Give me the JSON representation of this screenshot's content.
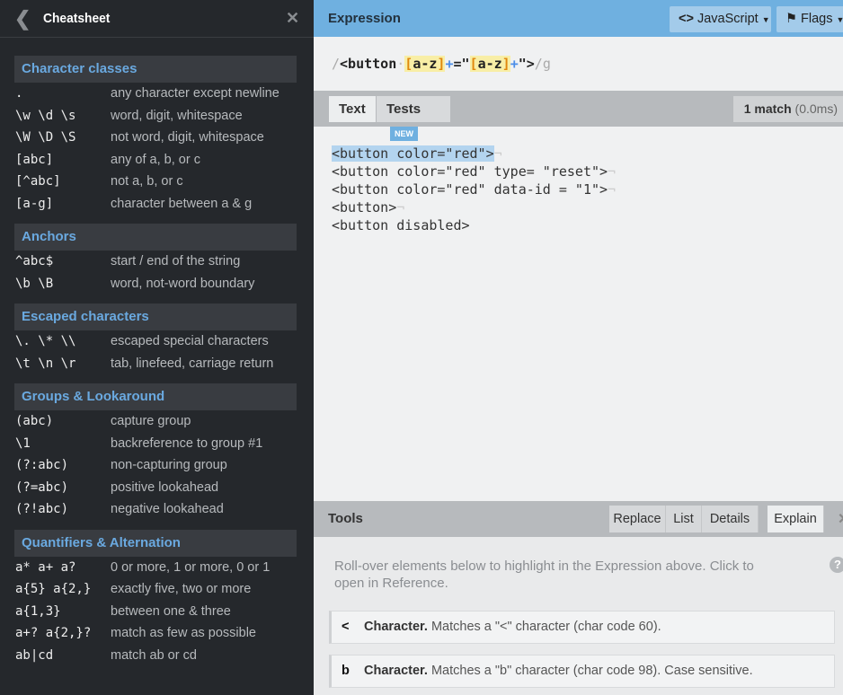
{
  "sidebar": {
    "title": "Cheatsheet",
    "back_icon": "chevron-left-icon",
    "close_icon": "close-icon",
    "sections": [
      {
        "title": "Character classes",
        "items": [
          [
            ".",
            "any character except newline"
          ],
          [
            "\\w \\d \\s",
            "word, digit, whitespace"
          ],
          [
            "\\W \\D \\S",
            "not word, digit, whitespace"
          ],
          [
            "[abc]",
            "any of a, b, or c"
          ],
          [
            "[^abc]",
            "not a, b, or c"
          ],
          [
            "[a-g]",
            "character between a & g"
          ]
        ]
      },
      {
        "title": "Anchors",
        "items": [
          [
            "^abc$",
            "start / end of the string"
          ],
          [
            "\\b \\B",
            "word, not-word boundary"
          ]
        ]
      },
      {
        "title": "Escaped characters",
        "items": [
          [
            "\\. \\* \\\\",
            "escaped special characters"
          ],
          [
            "\\t \\n \\r",
            "tab, linefeed, carriage return"
          ]
        ]
      },
      {
        "title": "Groups & Lookaround",
        "items": [
          [
            "(abc)",
            "capture group"
          ],
          [
            "\\1",
            "backreference to group #1"
          ],
          [
            "(?:abc)",
            "non-capturing group"
          ],
          [
            "(?=abc)",
            "positive lookahead"
          ],
          [
            "(?!abc)",
            "negative lookahead"
          ]
        ]
      },
      {
        "title": "Quantifiers & Alternation",
        "items": [
          [
            "a* a+ a?",
            "0 or more, 1 or more, 0 or 1"
          ],
          [
            "a{5} a{2,}",
            "exactly five, two or more"
          ],
          [
            "a{1,3}",
            "between one & three"
          ],
          [
            "a+? a{2,}?",
            "match as few as possible"
          ],
          [
            "ab|cd",
            "match ab or cd"
          ]
        ]
      }
    ]
  },
  "expression": {
    "label": "Expression",
    "flavor": "JavaScript",
    "flags_label": "Flags",
    "parts": {
      "open": "/",
      "lit1": "<button",
      "sp": "·",
      "set_open": "[",
      "set_body": "a-z",
      "set_close": "]",
      "plus": "+",
      "lit2": "=\"",
      "lit3": "\">",
      "close": "/",
      "flags": "g"
    },
    "regex": "/<button [a-z]+=\"[a-z]+\">/g"
  },
  "text_panel": {
    "tabs": [
      "Text",
      "Tests"
    ],
    "new_badge": "NEW",
    "match_count": "1 match",
    "match_time": "(0.0ms)",
    "lines": [
      "<button color=\"red\">",
      "<button color=\"red\" type= \"reset\">",
      "<button color=\"red\" data-id = \"1\">",
      "<button>",
      "<button disabled>"
    ]
  },
  "tools": {
    "label": "Tools",
    "tabs": [
      "Replace",
      "List",
      "Details",
      "Explain"
    ],
    "active_tab": "Explain",
    "intro": "Roll-over elements below to highlight in the Expression above. Click to open in Reference.",
    "explanations": [
      {
        "token": "<",
        "title": "Character.",
        "text": "Matches a \"<\" character (char code 60)."
      },
      {
        "token": "b",
        "title": "Character.",
        "text": "Matches a \"b\" character (char code 98). Case sensitive."
      }
    ]
  },
  "colors": {
    "sidebar_bg": "#25282c",
    "header_blue": "#6fb0e0",
    "section_title": "#6aa9e0",
    "set_highlight": "#f8eea6",
    "match_highlight": "#b3d4ef"
  }
}
